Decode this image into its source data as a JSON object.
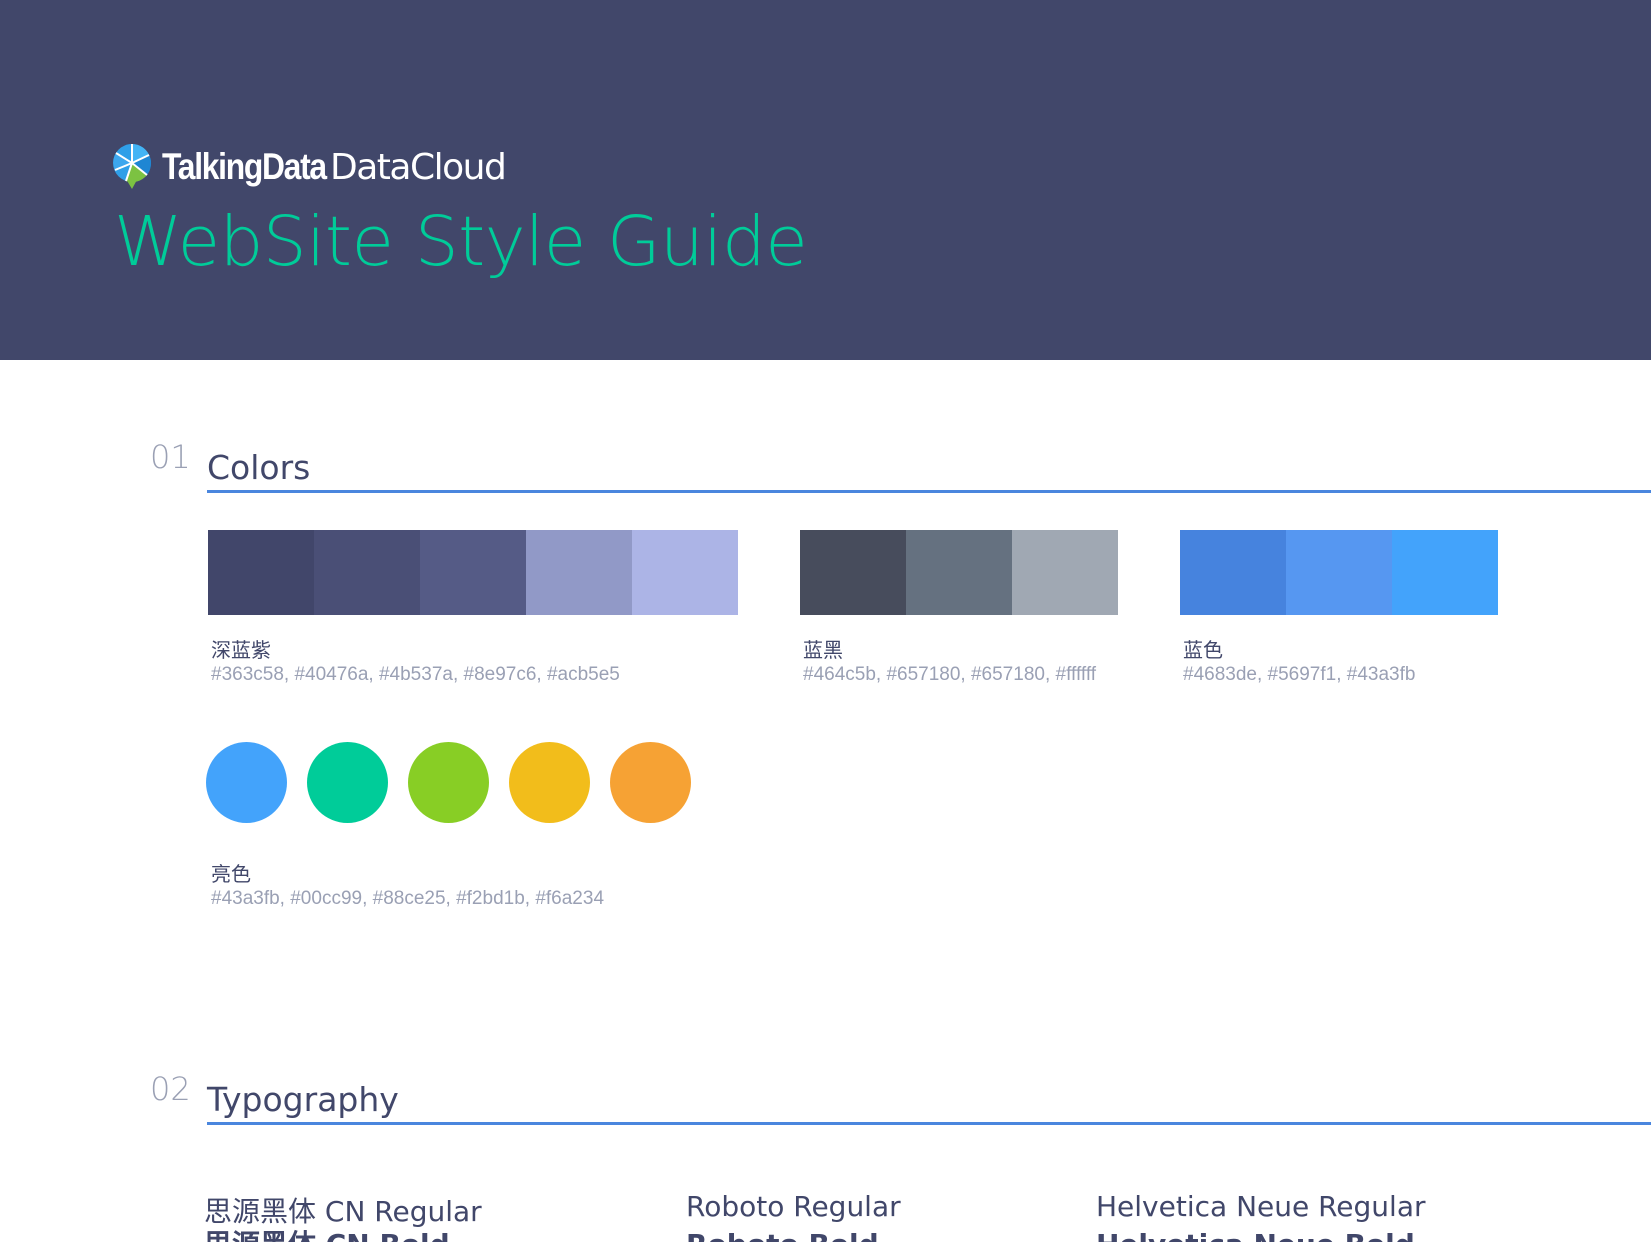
{
  "header": {
    "brand_name": "TalkingData",
    "product_name": "DataCloud",
    "title": "WebSite Style Guide",
    "logo_icon": "talkingdata-logo-icon",
    "background_color": "#41476a",
    "title_color": "#00cc99"
  },
  "sections": {
    "colors": {
      "number": "01",
      "title": "Colors"
    },
    "typography": {
      "number": "02",
      "title": "Typography"
    }
  },
  "palettes": [
    {
      "name": "深蓝紫",
      "codes": "#363c58, #40476a, #4b537a, #8e97c6, #acb5e5",
      "swatches": [
        "#41466a",
        "#4a4f76",
        "#555b86",
        "#9199c7",
        "#acb4e6"
      ]
    },
    {
      "name": "蓝黑",
      "codes": "#464c5b, #657180, #657180, #ffffff",
      "swatches": [
        "#474c5c",
        "#657180",
        "#a0a8b3"
      ]
    },
    {
      "name": "蓝色",
      "codes": "#4683de, #5697f1, #43a3fb",
      "swatches": [
        "#4683de",
        "#5697f1",
        "#43a3fb"
      ]
    }
  ],
  "bright_colors": {
    "name": "亮色",
    "codes": "#43a3fb, #00cc99, #88ce25, #f2bd1b, #f6a234",
    "dots": [
      "#43a3fb",
      "#00cc99",
      "#88ce25",
      "#f2bd1b",
      "#f6a234"
    ]
  },
  "typography": {
    "fonts": [
      {
        "regular": "思源黑体 CN Regular",
        "bold": "思源黑体 CN Bold"
      },
      {
        "regular": "Roboto Regular",
        "bold": "Roboto Bold"
      },
      {
        "regular": "Helvetica Neue Regular",
        "bold": "Helvetica Neue Bold"
      }
    ]
  },
  "accent_color": "#4a86de"
}
